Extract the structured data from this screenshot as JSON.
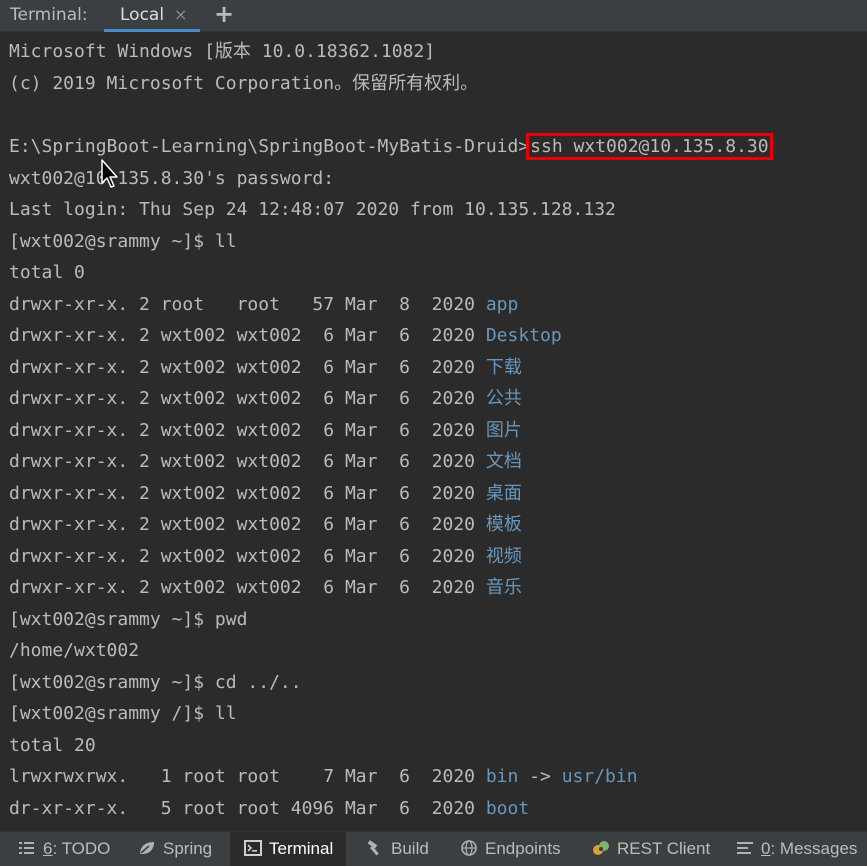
{
  "tabbar": {
    "title": "Terminal:",
    "tab_label": "Local",
    "close_symbol": "×",
    "add_symbol": "+"
  },
  "terminal": {
    "lines": [
      "Microsoft Windows [版本 10.0.18362.1082]",
      "(c) 2019 Microsoft Corporation。保留所有权利。",
      "",
      "",
      "wxt002@10.135.8.30's password:",
      "Last login: Thu Sep 24 12:48:07 2020 from 10.135.128.132",
      "[wxt002@srammy ~]$ ll",
      "total 0"
    ],
    "ssh_prompt": "E:\\SpringBoot-Learning\\SpringBoot-MyBatis-Druid>",
    "ssh_command": "ssh wxt002@10.135.8.30",
    "listing1": [
      {
        "meta": "drwxr-xr-x. 2 root   root   57 Mar  8  2020 ",
        "name": "app"
      },
      {
        "meta": "drwxr-xr-x. 2 wxt002 wxt002  6 Mar  6  2020 ",
        "name": "Desktop"
      },
      {
        "meta": "drwxr-xr-x. 2 wxt002 wxt002  6 Mar  6  2020 ",
        "name": "下载"
      },
      {
        "meta": "drwxr-xr-x. 2 wxt002 wxt002  6 Mar  6  2020 ",
        "name": "公共"
      },
      {
        "meta": "drwxr-xr-x. 2 wxt002 wxt002  6 Mar  6  2020 ",
        "name": "图片"
      },
      {
        "meta": "drwxr-xr-x. 2 wxt002 wxt002  6 Mar  6  2020 ",
        "name": "文档"
      },
      {
        "meta": "drwxr-xr-x. 2 wxt002 wxt002  6 Mar  6  2020 ",
        "name": "桌面"
      },
      {
        "meta": "drwxr-xr-x. 2 wxt002 wxt002  6 Mar  6  2020 ",
        "name": "模板"
      },
      {
        "meta": "drwxr-xr-x. 2 wxt002 wxt002  6 Mar  6  2020 ",
        "name": "视频"
      },
      {
        "meta": "drwxr-xr-x. 2 wxt002 wxt002  6 Mar  6  2020 ",
        "name": "音乐"
      }
    ],
    "after_listing": [
      "[wxt002@srammy ~]$ pwd",
      "/home/wxt002",
      "[wxt002@srammy ~]$ cd ../..",
      "[wxt002@srammy /]$ ll",
      "total 20"
    ],
    "listing2": [
      {
        "meta": "lrwxrwxrwx.   1 root root    7 Mar  6  2020 ",
        "name": "bin",
        "arrow": " -> ",
        "target": "usr/bin"
      },
      {
        "meta": "dr-xr-xr-x.   5 root root 4096 Mar  6  2020 ",
        "name": "boot"
      }
    ]
  },
  "toolbar": {
    "todo_num": "6",
    "todo_label": ": TODO",
    "spring": "Spring",
    "terminal": "Terminal",
    "build": "Build",
    "endpoints": "Endpoints",
    "rest_client": "REST Client",
    "messages_num": "0",
    "messages_label": ": Messages"
  },
  "colors": {
    "background": "#2b2b2b",
    "text": "#bbbbbb",
    "directory": "#6897bb",
    "highlight_box": "#e8000b",
    "active_tab_underline": "#4a88c7"
  },
  "icons": [
    "close-icon",
    "add-tab-icon",
    "mouse-cursor-icon",
    "todo-list-icon",
    "spring-leaf-icon",
    "terminal-icon",
    "build-hammer-icon",
    "endpoints-globe-icon",
    "rest-client-icon",
    "messages-icon"
  ]
}
